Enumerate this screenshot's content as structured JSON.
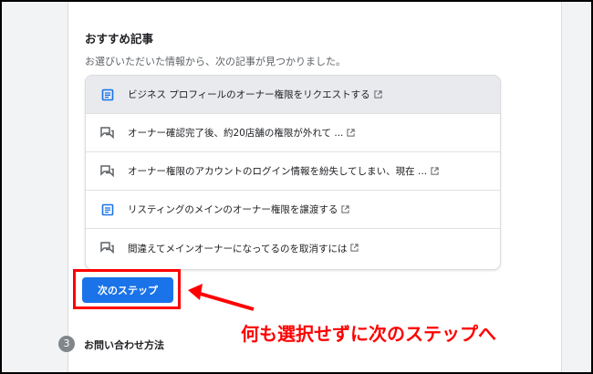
{
  "section": {
    "title": "おすすめ記事",
    "subtitle": "お選びいただいた情報から、次の記事が見つかりました。"
  },
  "articles": [
    {
      "label": "ビジネス プロフィールのオーナー権限をリクエストする",
      "icon": "article-icon"
    },
    {
      "label": "オーナー確認完了後、約20店舗の権限が外れて ...",
      "icon": "forum-icon"
    },
    {
      "label": "オーナー権限のアカウントのログイン情報を紛失してしまい、現在 ...",
      "icon": "forum-icon"
    },
    {
      "label": "リスティングのメインのオーナー権限を譲渡する",
      "icon": "article-icon"
    },
    {
      "label": "間違えてメインオーナーになってるのを取消すには",
      "icon": "forum-icon"
    }
  ],
  "next_button": {
    "label": "次のステップ"
  },
  "step": {
    "number": "3",
    "title": "お問い合わせ方法"
  },
  "annotation": {
    "text": "何も選択せずに次のステップへ"
  },
  "colors": {
    "accent": "#1a73e8",
    "highlight": "#ff0000",
    "article_icon": "#1a73e8",
    "forum_icon": "#5f6368"
  }
}
